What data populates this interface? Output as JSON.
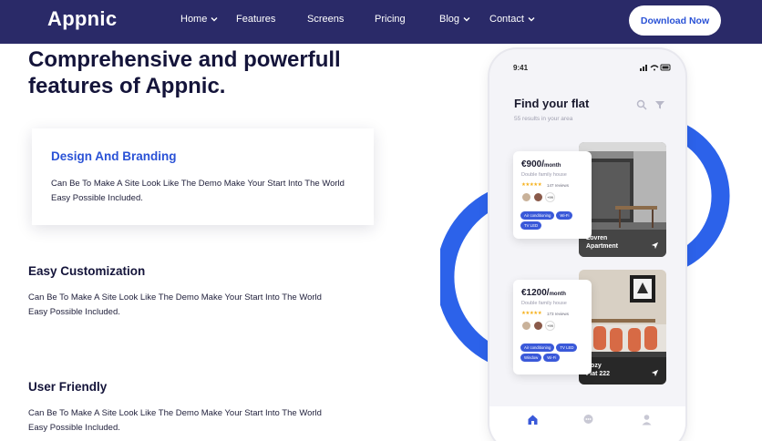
{
  "nav": {
    "logo": "Appnic",
    "items": [
      {
        "label": "Home",
        "dropdown": true
      },
      {
        "label": "Features",
        "dropdown": false
      },
      {
        "label": "Screens",
        "dropdown": false
      },
      {
        "label": "Pricing",
        "dropdown": false
      },
      {
        "label": "Blog",
        "dropdown": true
      },
      {
        "label": "Contact",
        "dropdown": true
      }
    ],
    "cta": "Download Now"
  },
  "hero": {
    "headline_line1": "Comprehensive and powerfull",
    "headline_line2": "features of Appnic."
  },
  "features": [
    {
      "title": "Design And Branding",
      "text": "Can Be To Make A Site Look Like The Demo Make Your Start Into The World Easy Possible Included.",
      "active": true
    },
    {
      "title": "Easy Customization",
      "text": "Can Be To Make A Site Look Like The Demo Make Your Start Into The World Easy Possible Included.",
      "active": false
    },
    {
      "title": "User Friendly",
      "text": "Can Be To Make A Site Look Like The Demo Make Your Start Into The World Easy Possible Included.",
      "active": false
    }
  ],
  "phone": {
    "time": "9:41",
    "title": "Find your flat",
    "subtitle": "55 results in your area",
    "listings": [
      {
        "price": "€900/",
        "per": "month",
        "type": "Double family house",
        "reviews": "147 reviews",
        "more": "+99",
        "tags": [
          "Air conditioning",
          "Wi-Fi",
          "TV LED"
        ],
        "name_line1": "Lovren",
        "name_line2": "Apartment"
      },
      {
        "price": "€1200/",
        "per": "month",
        "type": "Double family house",
        "reviews": "173 reviews",
        "more": "+99",
        "tags": [
          "Air conditioning",
          "TV LED",
          "Window",
          "Wi-Fi"
        ],
        "name_line1": "Cozy",
        "name_line2": "Flat 222"
      }
    ]
  },
  "colors": {
    "nav_bg": "#2a2a68",
    "accent": "#2a52d6",
    "ring": "#2c62ea",
    "heading": "#14143a"
  },
  "icons": {
    "dropdown": "chevron-down-icon",
    "search": "search-icon",
    "filter": "filter-icon",
    "location": "location-arrow-icon",
    "home_tab": "home-icon",
    "chat_tab": "chat-icon",
    "profile_tab": "profile-icon"
  }
}
